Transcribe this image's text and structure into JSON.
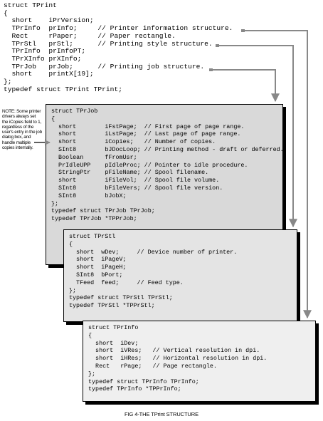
{
  "top_struct": {
    "lines": [
      "struct TPrint",
      "{",
      "  short    iPrVersion;",
      "  TPrInfo  prInfo;     // Printer information structure.",
      "  Rect     rPaper;     // Paper rectangle.",
      "  TPrStl   prStl;      // Printing style structure.",
      "  TPrInfo  prInfoPT;",
      "  TPrXInfo prXInfo;",
      "  TPrJob   prJob;      // Printing job structure.",
      "  short    printX[19];",
      "};",
      "typedef struct TPrint TPrint;"
    ]
  },
  "job_box": {
    "lines": [
      "struct TPrJob",
      "{",
      "  short        iFstPage;  // First page of page range.",
      "  short        iLstPage;  // Last page of page range.",
      "  short        iCopies;   // Number of copies.",
      "  SInt8        bJDocLoop; // Printing method - draft or deferred.",
      "  Boolean      fFromUsr;",
      "  PrIdleUPP    pIdleProc; // Pointer to idle procedure.",
      "  StringPtr    pFileName; // Spool filename.",
      "  short        iFileVol;  // Spool file volume.",
      "  SInt8        bFileVers; // Spool file version.",
      "  SInt8        bJobX;",
      "};",
      "typedef struct TPrJob TPrJob;",
      "typedef TPrJob *TPPrJob;"
    ]
  },
  "stl_box": {
    "lines": [
      "struct TPrStl",
      "{",
      "  short  wDev;     // Device number of printer.",
      "  short  iPageV;",
      "  short  iPageH;",
      "  SInt8  bPort;",
      "  TFeed  feed;     // Feed type.",
      "};",
      "typedef struct TPrStl TPrStl;",
      "typedef TPrStl *TPPrStl;"
    ]
  },
  "info_box": {
    "lines": [
      "struct TPrInfo",
      "{",
      "  short  iDev;",
      "  short  iVRes;   // Vertical resolution in dpi.",
      "  short  iHRes;   // Horizontal resolution in dpi.",
      "  Rect   rPage;   // Page rectangle.",
      "};",
      "typedef struct TPrInfo TPrInfo;",
      "typedef TPrInfo *TPPrInfo;"
    ]
  },
  "note": "NOTE: Some printer drivers always set the iCopies field to 1, regardless of the user's entry in the job dialog box, and handle multiple copies internally.",
  "caption": "FIG 4-THE TPrint STRUCTURE",
  "colors": {
    "job_fill": "#d9d9d9",
    "stl_fill": "#e4e4e4",
    "info_fill": "#efefef",
    "connector": "#888888"
  }
}
